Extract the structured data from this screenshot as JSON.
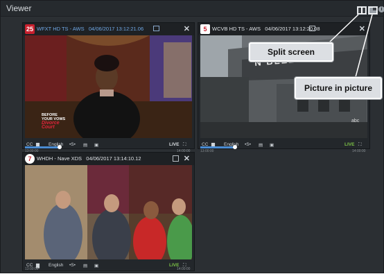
{
  "app": {
    "title": "Viewer"
  },
  "toolbar": {
    "info": "i"
  },
  "panels": [
    {
      "logo_text": "25",
      "channel": "WFXT HD TS - AWS",
      "timestamp": "04/06/2017 13:12:21.06",
      "cc": "CC",
      "language": "English",
      "speed": "•S•",
      "live": "LIVE",
      "time_start": "13:00:00",
      "time_end": "14:00:00",
      "overlay_text_1": "BEFORE",
      "overlay_text_2": "YOUR VOWS",
      "overlay_text_3": "Divorce",
      "overlay_text_4": "Court"
    },
    {
      "logo_text": "5",
      "channel": "WCVB HD TS - AWS",
      "timestamp": "04/06/2017 13:12:20.08",
      "cc": "CC",
      "language": "English",
      "speed": "•S•",
      "live": "LIVE",
      "time_start": "13:00:00",
      "time_end": "14:00:00",
      "sign_text": "N BLEECKE",
      "overlay_text": "abc"
    },
    {
      "logo_text": "7",
      "channel": "WHDH - Nave XDS",
      "timestamp": "04/06/2017 13:14:10.12",
      "cc": "CC",
      "language": "English",
      "speed": "•S•",
      "live": "LIVE",
      "time_start": "13:00:00",
      "time_end": "14:00:00"
    }
  ],
  "callouts": {
    "split": "Split screen",
    "pip": "Picture in picture"
  },
  "colors": {
    "accent": "#4a8cd3",
    "live": "#7cc246"
  }
}
